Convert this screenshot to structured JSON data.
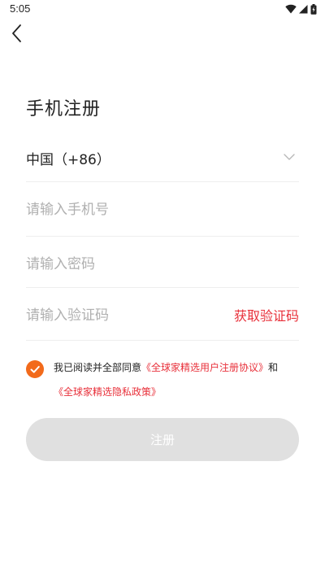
{
  "status_bar": {
    "time": "5:05",
    "icons": [
      "wifi-icon",
      "signal-icon",
      "battery-icon"
    ]
  },
  "header": {
    "back_icon": "back-arrow-icon",
    "title": "手机注册"
  },
  "form": {
    "country_value": "中国（+86）",
    "country_icon": "chevron-down-icon",
    "phone_placeholder": "请输入手机号",
    "password_placeholder": "请输入密码",
    "code_placeholder": "请输入验证码",
    "get_code_label": "获取验证码"
  },
  "agreement": {
    "checked": true,
    "prefix": "我已阅读并全部同意",
    "user_agreement_link": "《全球家精选用户注册协议》",
    "connector": "和",
    "privacy_link": "《全球家精选隐私政策》"
  },
  "register_button_label": "注册",
  "colors": {
    "accent_red": "#e8303a",
    "check_orange": "#f26a1b",
    "button_disabled": "#e0e0e0",
    "placeholder": "#b0b0b0"
  }
}
